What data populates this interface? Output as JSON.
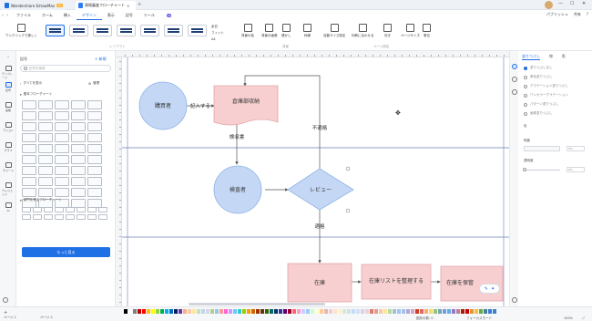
{
  "titlebar": {
    "app_tab": "Wondershare EdrawMax",
    "app_badge": "Pro",
    "doc_tab": "資格審査フローチャート",
    "new_tab": "+",
    "minimize": "—",
    "maximize": "☐",
    "close": "✕"
  },
  "menubar": {
    "back": "‹",
    "forward": "›",
    "file": "ファイル",
    "items": [
      "ホーム",
      "挿入",
      "デザイン",
      "表示",
      "記号",
      "ツール",
      "AI"
    ],
    "active_index": 2,
    "right": [
      "パブリッシュ",
      "共有",
      "?"
    ]
  },
  "ribbon": {
    "buttons": [
      "ワンクリックで美しく",
      "背景の色",
      "背景の画像",
      "透かし",
      "枠線",
      "タイトル",
      "背景を消去",
      "背景の色",
      "用紙",
      "ページサイズ",
      "用紙の向き",
      "単位"
    ],
    "labels": {
      "layout_caption": "レイアウト",
      "background_caption": "背景",
      "page_caption": "ページ設定"
    },
    "size_options": [
      "余白",
      "フィット",
      "A4"
    ],
    "btn_bg_color": "背景の色",
    "btn_bg_image": "背景の画像",
    "btn_watermark": "透かし",
    "btn_border": "枠線",
    "btn_remove_bg": "背景を消去",
    "btn_auto_size": "自動サイズ設定",
    "btn_fit": "印刷に合わせる",
    "btn_orientation": "向き",
    "btn_page_size": "ページサイズ",
    "btn_unit": "単位",
    "btn_one_click": "ワンクリックで美しく"
  },
  "rail": {
    "items": [
      "テンプレート",
      "記号",
      "画像",
      "アイコン",
      "グラフ",
      "チャート",
      "ウィジェット",
      "AI"
    ],
    "active_index": 1
  },
  "library": {
    "title": "記号",
    "new_button": "+ 新規",
    "search_placeholder": "記号を検索",
    "row_more": "すべてを表示",
    "row_manage": "管理",
    "section_basic": "基本フローチャート",
    "section_cross": "部門を跨るフローチャート",
    "more_button": "もっと見る"
  },
  "diagram": {
    "nodes": {
      "applicant": "購買者",
      "inventory_doc": "倉庫部収納",
      "checker": "検査者",
      "review": "レビュー",
      "stock": "在庫",
      "register": "在庫リストを整理する",
      "store": "在庫を保管"
    },
    "edges": {
      "fill_in": "記入する",
      "report": "検収書",
      "reject": "不適格",
      "pass": "適格"
    },
    "colors": {
      "circle_fill": "#c4d8f6",
      "circle_stroke": "#8fb1e6",
      "rect_fill": "#f7cfd0",
      "rect_stroke": "#e3a6a8",
      "diamond_fill": "#c4d8f6",
      "diamond_stroke": "#8fb1e6",
      "lane_line": "#6b7fb7",
      "connector": "#555555"
    }
  },
  "float_button": {
    "left": "✎",
    "right": "✦"
  },
  "format_panel": {
    "tabs": [
      "塗りつぶし",
      "線",
      "影"
    ],
    "active_tab": 0,
    "options": [
      "塗りつぶしなし",
      "単色塗りつぶし",
      "グラデーション塗りつぶし",
      "ワンカラーグラデーション",
      "パターン塗りつぶし",
      "画像塗りつぶし"
    ],
    "selected_option": 0,
    "color_label": "色",
    "shade_label": "明度",
    "transparency_label": "透明度",
    "shade_value": "0%",
    "transparency_value": "0%"
  },
  "statusbar": {
    "pages": [
      "ページ-1",
      "ページ-1"
    ],
    "shapes_count": "図形の数: 0",
    "focus_mode": "フォーカスモード",
    "zoom": "100%",
    "fit": "⤢"
  },
  "palette": [
    "#000000",
    "#ffffff",
    "#7f7f7f",
    "#c00000",
    "#ff0000",
    "#ffc000",
    "#ffff00",
    "#92d050",
    "#00b050",
    "#00b0f0",
    "#0070c0",
    "#002060",
    "#7030a0",
    "#f4b183",
    "#f8cbad",
    "#ffe699",
    "#c5e0b4",
    "#bdd7ee",
    "#d9d2e9",
    "#a9d18e",
    "#9dc3e6",
    "#ff9999",
    "#ff66cc",
    "#cc99ff",
    "#66ccff",
    "#33cccc",
    "#99cc00",
    "#ff9900",
    "#cc6600",
    "#993300",
    "#663300",
    "#336600",
    "#006666",
    "#003366",
    "#333399",
    "#660066",
    "#990033",
    "#ff6666",
    "#ff99cc",
    "#ccccff",
    "#99ccff",
    "#ccffcc",
    "#ffffcc",
    "#ffcc99",
    "#e6b8af",
    "#f4cccc",
    "#fce5cd",
    "#fff2cc",
    "#d9ead3",
    "#d0e0e3",
    "#c9daf8",
    "#cfe2f3",
    "#d9d2e9",
    "#ead1dc",
    "#dd7e6b",
    "#ea9999",
    "#f9cb9c",
    "#ffe599",
    "#b6d7a8",
    "#a2c4c9",
    "#a4c2f4",
    "#9fc5e8",
    "#b4a7d6",
    "#d5a6bd",
    "#cc4125",
    "#e06666",
    "#f6b26b",
    "#ffd966",
    "#93c47d",
    "#76a5af",
    "#6d9eeb",
    "#6fa8dc",
    "#8e7cc3",
    "#c27ba0",
    "#a61c00",
    "#cc0000",
    "#e69138",
    "#f1c232",
    "#6aa84f",
    "#45818e",
    "#3c78d8",
    "#3d85c6",
    "#674ea7",
    "#a64d79"
  ]
}
